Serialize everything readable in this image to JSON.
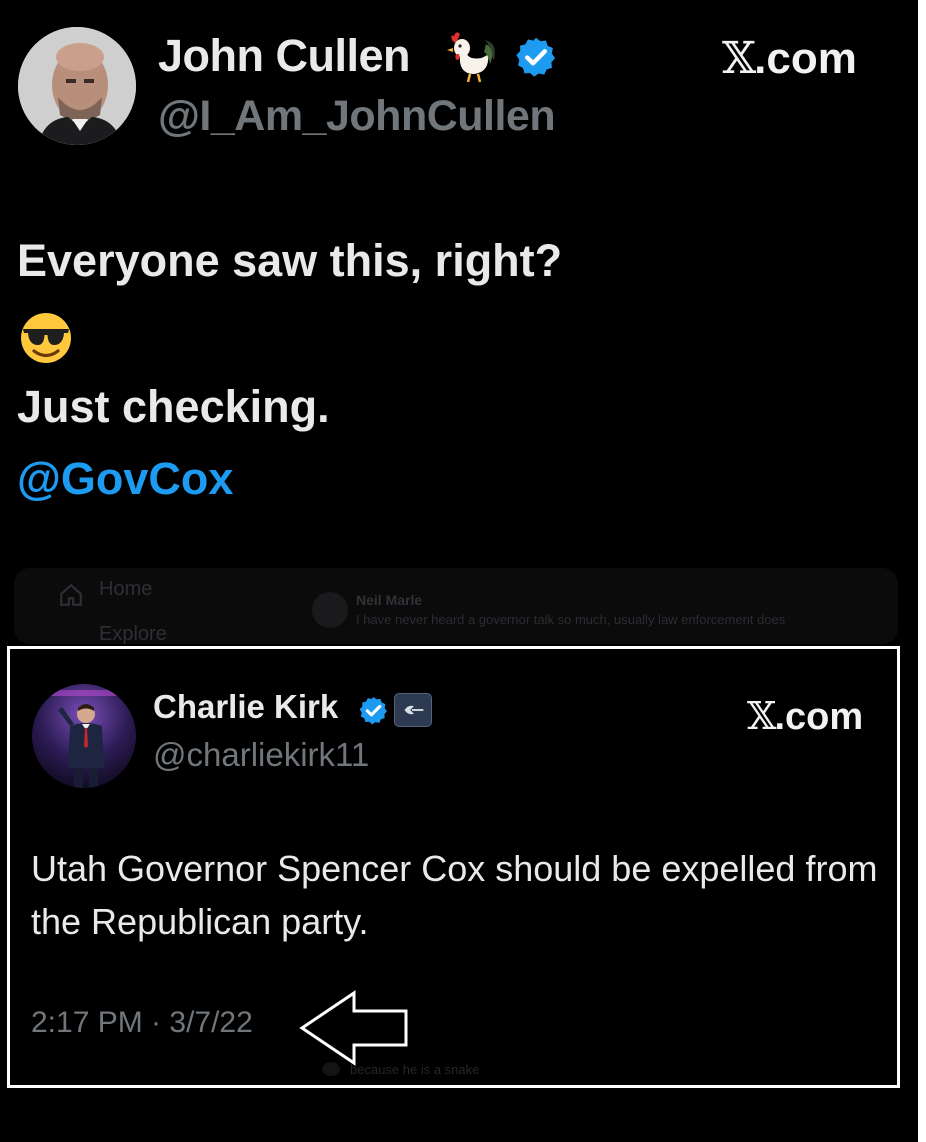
{
  "top_tweet": {
    "author_name": "John Cullen",
    "handle": "@I_Am_JohnCullen",
    "name_emoji": "rooster-emoji",
    "verified_icon": "verified-badge-icon",
    "site_label_x": "𝕏",
    "site_label_rest": ".com",
    "lines": [
      "Everyone saw this, right?",
      "Just checking."
    ],
    "emoji": "smiling-face-with-sunglasses",
    "mention": "@GovCox"
  },
  "background_ui": {
    "nav_home": "Home",
    "nav_explore": "Explore",
    "bg_author": "Neil Marle",
    "bg_text": "I have never heard a governor talk so much, usually law enforcement does",
    "bg_bottom_text": "because he is a snake"
  },
  "quoted_tweet": {
    "author_name": "Charlie Kirk",
    "handle": "@charliekirk11",
    "verified_icon": "verified-badge-icon",
    "affiliation_icon": "organization-badge-icon",
    "site_label_x": "𝕏",
    "site_label_rest": ".com",
    "text": "Utah Governor Spencer Cox should be expelled from the Republican party.",
    "timestamp": "2:17 PM · 3/7/22"
  },
  "annotation": {
    "arrow_icon": "left-arrow-outline-icon",
    "border_color": "#ffffff"
  },
  "colors": {
    "background": "#000000",
    "primary_text": "#e7e9ea",
    "secondary_text": "#71767b",
    "mention_blue": "#1d9bf0",
    "verified_blue": "#1d9bf0"
  }
}
